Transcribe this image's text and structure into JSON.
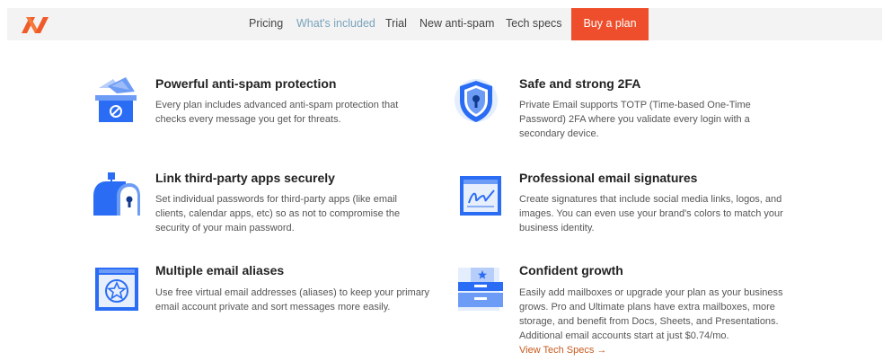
{
  "nav": {
    "logo_name": "namecheap-logo",
    "links": [
      "Pricing",
      "What's included",
      "Trial",
      "New anti-spam",
      "Tech specs"
    ],
    "active_index": 1,
    "buy_label": "Buy a plan",
    "accent_color": "#ee4e2b",
    "active_color": "#7aa4bc"
  },
  "features": [
    {
      "icon": "spam-box-icon",
      "title": "Powerful anti-spam protection",
      "lines": [
        "Every plan includes advanced anti-spam protection that",
        "checks every message you get for threats."
      ]
    },
    {
      "icon": "shield-lock-icon",
      "title": "Safe and strong 2FA",
      "lines": [
        "Private Email supports TOTP (Time-based One-Time",
        "Password) 2FA where you validate every login with a",
        "secondary device."
      ]
    },
    {
      "icon": "mailbox-lock-icon",
      "title": "Link third-party apps securely",
      "lines": [
        "Set individual passwords for third-party apps (like email",
        "clients, calendar apps, etc) so as not to compromise the",
        "security of your main password."
      ]
    },
    {
      "icon": "signature-icon",
      "title": "Professional email signatures",
      "lines": [
        "Create signatures that include social media links, logos, and",
        "images. You can even use your brand's colors to match your",
        "business identity."
      ]
    },
    {
      "icon": "star-browser-icon",
      "title": "Multiple email aliases",
      "lines": [
        "Use free virtual email addresses (aliases) to keep your primary",
        "email account private and sort messages more easily."
      ]
    },
    {
      "icon": "drawer-growth-icon",
      "title": "Confident growth",
      "lines": [
        "Easily add mailboxes or upgrade your plan as your business",
        "grows. Pro and Ultimate plans have extra mailboxes, more",
        "storage, and benefit from Docs, Sheets, and Presentations.",
        "Additional email accounts start at just $0.74/mo."
      ],
      "link": "View Tech Specs →"
    }
  ]
}
